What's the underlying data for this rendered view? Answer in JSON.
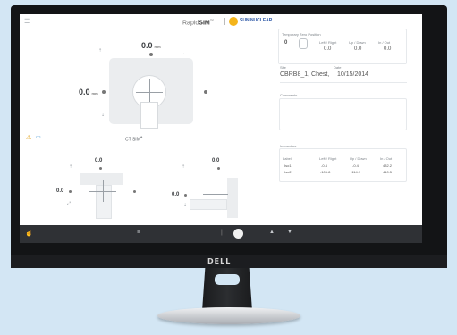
{
  "monitor": {
    "brand": "DELL"
  },
  "app": {
    "title_prefix": "Rapid",
    "title_strong": "SIM",
    "title_tm": "™",
    "separator": "|",
    "company": "SUN NUCLEAR"
  },
  "right_panel": {
    "couch_title": "Temporary Zero Position",
    "couch_value_label": "0",
    "couch_headers": [
      "Left / Right",
      "Up / Down",
      "In / Out"
    ],
    "couch_values": [
      "0.0",
      "0.0",
      "0.0"
    ],
    "site_label": "Site",
    "site_value": "CBRB8_1, Chest,",
    "date_label": "Date",
    "date_value": "10/15/2014",
    "comments_label": "Comments",
    "isocenter_label": "Isocenters",
    "iso_col_headers": [
      "Left / Right",
      "Up / Down",
      "In / Out"
    ],
    "iso_rows": [
      {
        "name": "Iso1",
        "vals": [
          "-0.4",
          "-0.4",
          "432.2"
        ]
      },
      {
        "name": "Iso2",
        "vals": [
          "-106.8",
          "-114.9",
          "410.5"
        ]
      }
    ]
  },
  "main_view": {
    "top_value": "0.0",
    "top_unit": "mm",
    "left_value": "0.0",
    "left_unit": "mm",
    "ct_label": "CT SIM",
    "small_values": [
      "0.0",
      "0.0",
      "0.0",
      "0.0"
    ]
  },
  "toolbar": {
    "icons": [
      "pointer-icon",
      "menu-icon",
      "record-icon",
      "up-icon",
      "down-icon"
    ]
  }
}
